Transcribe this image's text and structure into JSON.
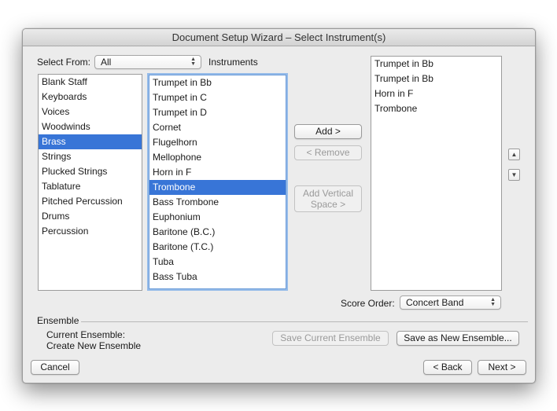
{
  "window": {
    "title": "Document Setup Wizard – Select Instrument(s)"
  },
  "select_from": {
    "label": "Select From:",
    "value": "All",
    "instruments_label": "Instruments"
  },
  "icons": {
    "popup_arrows": "updown-arrows-icon",
    "move_up": "chevron-up-icon",
    "move_down": "chevron-down-icon"
  },
  "categories": {
    "items": [
      "Blank Staff",
      "Keyboards",
      "Voices",
      "Woodwinds",
      "Brass",
      "Strings",
      "Plucked Strings",
      "Tablature",
      "Pitched Percussion",
      "Drums",
      "Percussion"
    ],
    "selected_index": 4
  },
  "instruments": {
    "items": [
      "Trumpet in Bb",
      "Trumpet in C",
      "Trumpet in D",
      "Cornet",
      "Flugelhorn",
      "Mellophone",
      "Horn in F",
      "Trombone",
      "Bass Trombone",
      "Euphonium",
      "Baritone (B.C.)",
      "Baritone (T.C.)",
      "Tuba",
      "Bass Tuba"
    ],
    "selected_index": 7
  },
  "buttons": {
    "add": "Add >",
    "remove": "< Remove",
    "add_vertical_space": "Add Vertical Space >",
    "save_current_ensemble": "Save Current Ensemble",
    "save_as_new_ensemble": "Save as New Ensemble...",
    "cancel": "Cancel",
    "back": "< Back",
    "next": "Next >"
  },
  "selected_instruments": [
    "Trumpet in Bb",
    "Trumpet in Bb",
    "Horn in F",
    "Trombone"
  ],
  "score_order": {
    "label": "Score Order:",
    "value": "Concert Band"
  },
  "ensemble": {
    "heading": "Ensemble",
    "current": "Current Ensemble:",
    "create": "Create New Ensemble"
  }
}
